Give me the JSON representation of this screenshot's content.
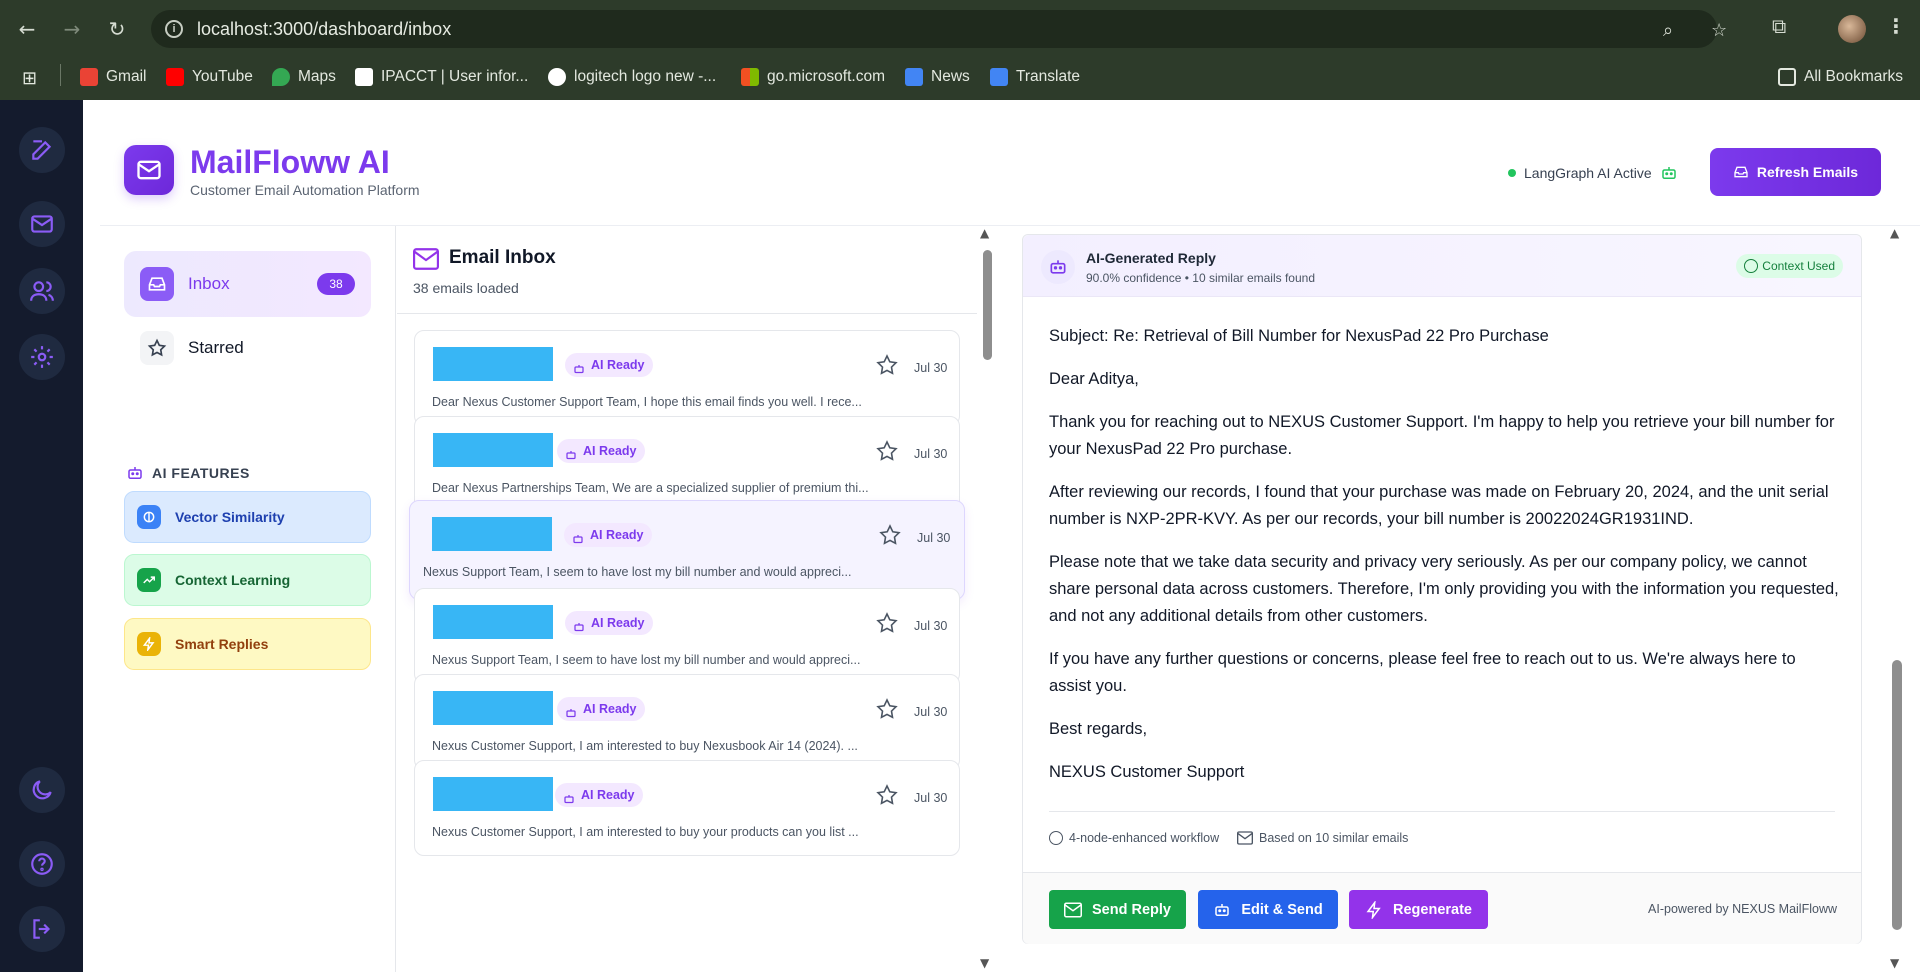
{
  "browser": {
    "url": "localhost:3000/dashboard/inbox",
    "bookmarks": [
      {
        "label": "Gmail",
        "color": "#ea4335"
      },
      {
        "label": "YouTube",
        "color": "#ff0000"
      },
      {
        "label": "Maps",
        "color": "#34a853"
      },
      {
        "label": "IPACCT | User infor...",
        "color": "#ffffff"
      },
      {
        "label": "logitech logo new -...",
        "color": "#ffffff"
      },
      {
        "label": "go.microsoft.com",
        "color": "#f25022"
      },
      {
        "label": "News",
        "color": "#4285f4"
      },
      {
        "label": "Translate",
        "color": "#4285f4"
      }
    ],
    "all_bookmarks": "All Bookmarks"
  },
  "header": {
    "title": "MailFloww AI",
    "subtitle": "Customer Email Automation Platform",
    "status": "LangGraph AI Active",
    "refresh_label": "Refresh Emails"
  },
  "sidebar": {
    "inbox_label": "Inbox",
    "inbox_count": "38",
    "starred_label": "Starred",
    "features_heading": "AI FEATURES",
    "features": [
      {
        "label": "Vector Similarity"
      },
      {
        "label": "Context Learning"
      },
      {
        "label": "Smart Replies"
      }
    ]
  },
  "inbox": {
    "title": "Email Inbox",
    "count_text": "38 emails loaded",
    "emails": [
      {
        "badge": "AI Ready",
        "date": "Jul 30",
        "preview": "Dear Nexus Customer Support Team, I hope this email finds you well. I rece..."
      },
      {
        "badge": "AI Ready",
        "date": "Jul 30",
        "preview": "Dear Nexus Partnerships Team, We are a specialized supplier of premium thi..."
      },
      {
        "badge": "AI Ready",
        "date": "Jul 30",
        "preview": "Nexus Support Team, I seem to have lost my bill number and would appreci..."
      },
      {
        "badge": "AI Ready",
        "date": "Jul 30",
        "preview": "Nexus Support Team, I seem to have lost my bill number and would appreci..."
      },
      {
        "badge": "AI Ready",
        "date": "Jul 30",
        "preview": "Nexus Customer Support, I am interested to buy Nexusbook Air 14 (2024). ..."
      },
      {
        "badge": "AI Ready",
        "date": "Jul 30",
        "preview": "Nexus Customer Support, I am interested to buy your products can you list ..."
      }
    ]
  },
  "reply": {
    "title": "AI-Generated Reply",
    "meta": "90.0% confidence • 10 similar emails found",
    "context_badge": "Context Used",
    "subject": "Subject: Re: Retrieval of Bill Number for NexusPad 22 Pro Purchase",
    "greeting": "Dear Aditya,",
    "p1": "Thank you for reaching out to NEXUS Customer Support. I'm happy to help you retrieve your bill number for your NexusPad 22 Pro purchase.",
    "p2": "After reviewing our records, I found that your purchase was made on February 20, 2024, and the unit serial number is NXP-2PR-KVY. As per our records, your bill number is 20022024GR1931IND.",
    "p3": "Please note that we take data security and privacy very seriously. As per our company policy, we cannot share personal data across customers. Therefore, I'm only providing you with the information you requested, and not any additional details from other customers.",
    "p4": "If you have any further questions or concerns, please feel free to reach out to us. We're always here to assist you.",
    "closing": "Best regards,",
    "signature": "NEXUS Customer Support",
    "workflow": "4-node-enhanced workflow",
    "based_on": "Based on 10 similar emails",
    "send_label": "Send Reply",
    "edit_label": "Edit & Send",
    "regen_label": "Regenerate",
    "powered": "AI-powered by NEXUS MailFloww"
  },
  "colors": {
    "accent": "#7c3aed",
    "send": "#16a34a",
    "edit": "#2563eb",
    "regen": "#9333ea"
  }
}
